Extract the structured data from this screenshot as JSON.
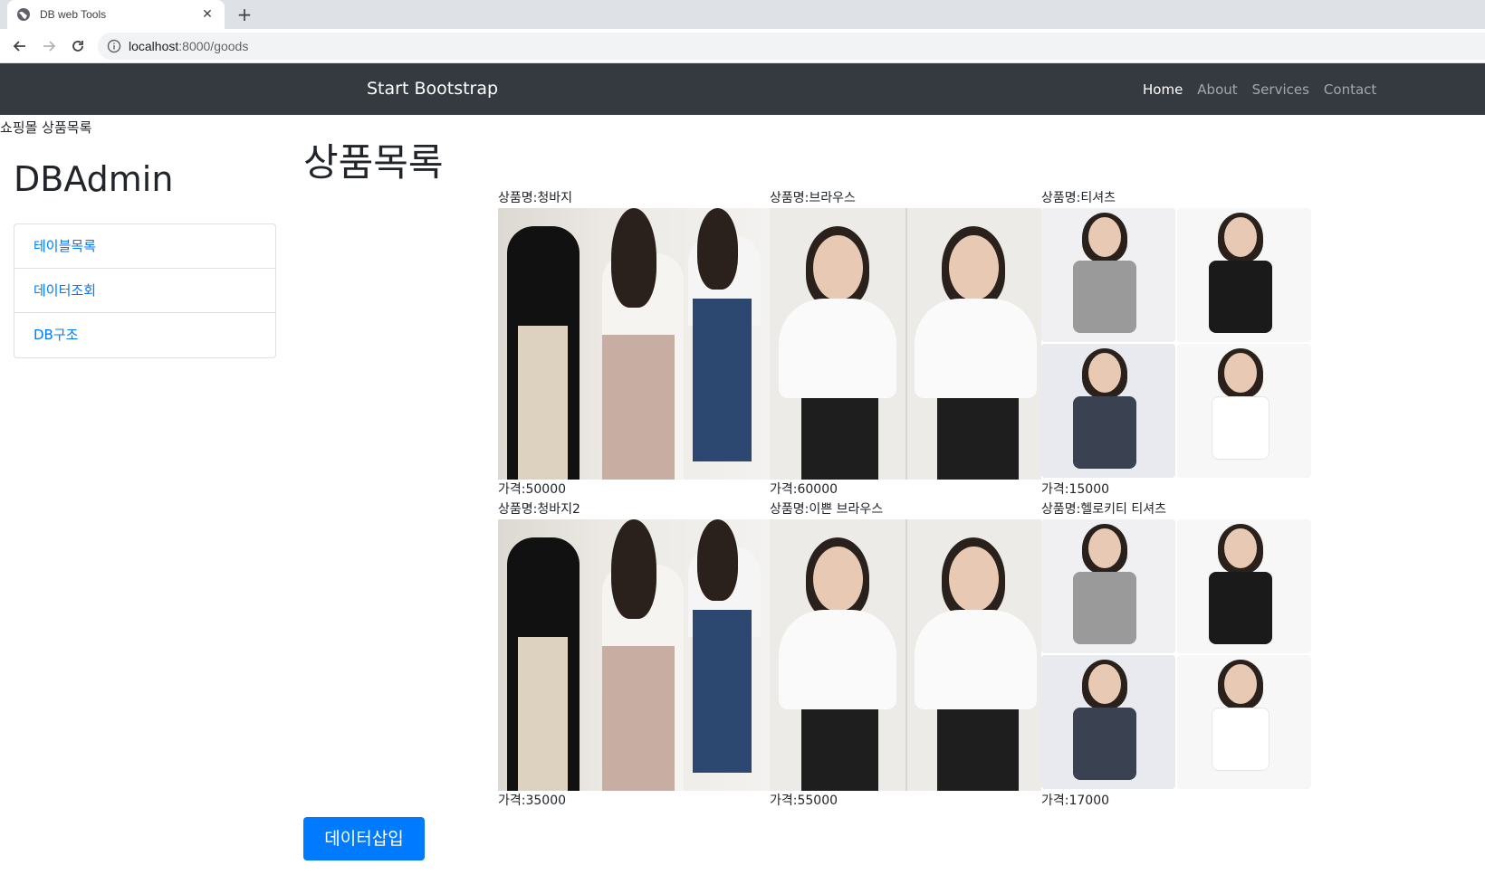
{
  "browser": {
    "tab_title": "DB web Tools",
    "url_host": "localhost",
    "url_path": ":8000/goods"
  },
  "navbar": {
    "brand": "Start Bootstrap",
    "links": [
      "Home",
      "About",
      "Services",
      "Contact"
    ],
    "active": "Home"
  },
  "page": {
    "subtitle": "쇼핑몰 상품목록",
    "sidebar_title": "DBAdmin",
    "sidebar_items": [
      "테이블목록",
      "데이터조회",
      "DB구조"
    ],
    "heading": "상품목록",
    "insert_button": "데이터삽입"
  },
  "products": [
    {
      "name": "상품명:청바지",
      "price": "가격:50000",
      "image": "pants"
    },
    {
      "name": "상품명:브라우스",
      "price": "가격:60000",
      "image": "blouse"
    },
    {
      "name": "상품명:티셔츠",
      "price": "가격:15000",
      "image": "tshirt"
    },
    {
      "name": "상품명:청바지2",
      "price": "가격:35000",
      "image": "pants"
    },
    {
      "name": "상품명:이쁜 브라우스",
      "price": "가격:55000",
      "image": "blouse"
    },
    {
      "name": "상품명:헬로키티 티셔츠",
      "price": "가격:17000",
      "image": "tshirt"
    }
  ],
  "colors": {
    "navbar_bg": "#343a40",
    "link": "#007bff",
    "button": "#007bff"
  }
}
